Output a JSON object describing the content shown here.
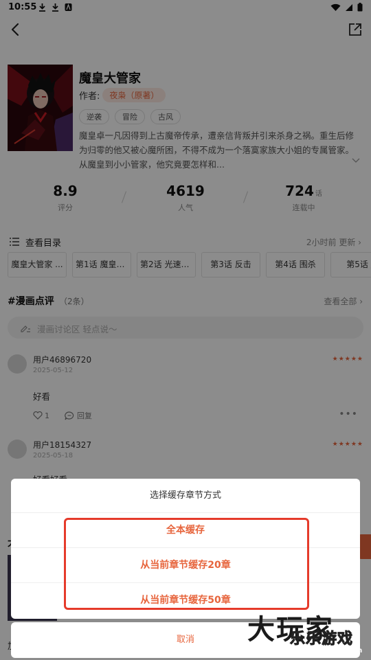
{
  "status_bar": {
    "time": "10:55",
    "icons": [
      "download-icon",
      "download-icon",
      "app-notification-icon"
    ],
    "right_icons": [
      "wifi-icon",
      "signal-icon",
      "battery-icon"
    ]
  },
  "nav": {
    "back_icon": "chevron-left-icon",
    "share_icon": "share-icon"
  },
  "book": {
    "title": "魔皇大管家",
    "author_label": "作者:",
    "author_name": "夜枭（原著）",
    "tags": [
      "逆袭",
      "冒险",
      "古风"
    ],
    "description": "魔皇卓一凡因得到上古魔帝传承，遭亲信背叛并引来杀身之祸。重生后修为归零的他又被心魔所困，不得不成为一个落寞家族大小姐的专属管家。从魔皇到小小管家，他究竟要怎样和..."
  },
  "stats": [
    {
      "value": "8.9",
      "unit": "",
      "label": "评分"
    },
    {
      "value": "4619",
      "unit": "",
      "label": "人气"
    },
    {
      "value": "724",
      "unit": "话",
      "label": "连载中"
    }
  ],
  "catalog": {
    "label": "查看目录",
    "update": "2小时前 更新 ›",
    "chapters": [
      "魔皇大管家 ...",
      "第1话 魔皇的...",
      "第2话 光速突...",
      "第3话 反击",
      "第4话 围杀",
      "第5话 /"
    ]
  },
  "reviews": {
    "title": "#漫画点评",
    "count": "（2条）",
    "view_all": "查看全部 ›",
    "input_placeholder": "漫画讨论区 轻点说～",
    "comments": [
      {
        "user": "用户46896720",
        "date": "2025-05-12",
        "stars": "★★★★★",
        "text": "好看",
        "likes": "1",
        "reply": "回复"
      },
      {
        "user": "用户18154327",
        "date": "2025-05-18",
        "stars": "★★★★★",
        "text": "好看好看"
      }
    ]
  },
  "background": {
    "section_peek": "大",
    "bottom_peek": "加"
  },
  "dialog": {
    "title": "选择缓存章节方式",
    "options": [
      "全本缓存",
      "从当前章节缓存20章",
      "从当前章节缓存50章"
    ],
    "cancel": "取消"
  },
  "watermark": {
    "big": "大玩家",
    "logo": "乐乐游戏",
    "url": "www.61l.com"
  },
  "colors": {
    "accent": "#e7653d",
    "highlight": "#e53a2a"
  }
}
